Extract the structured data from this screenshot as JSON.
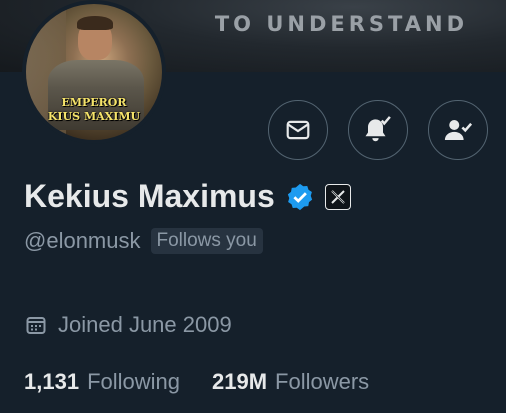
{
  "banner": {
    "text": "TO UNDERSTAND"
  },
  "avatar": {
    "line1": "EMPEROR",
    "line2": "KIUS MAXIMU"
  },
  "actions": {
    "message_icon": "mail-icon",
    "notify_icon": "bell-check-icon",
    "follow_icon": "person-check-icon"
  },
  "profile": {
    "display_name": "Kekius Maximus",
    "verified_icon": "verified-badge-icon",
    "affiliate_icon": "x-logo-icon",
    "handle": "@elonmusk",
    "follows_you": "Follows you",
    "joined": "Joined June 2009"
  },
  "stats": {
    "following_count": "1,131",
    "following_label": "Following",
    "followers_count": "219M",
    "followers_label": "Followers"
  },
  "colors": {
    "background": "#15202b",
    "text_primary": "#e7e9ea",
    "text_secondary": "#8b98a5",
    "verified_blue": "#1d9bf0"
  }
}
